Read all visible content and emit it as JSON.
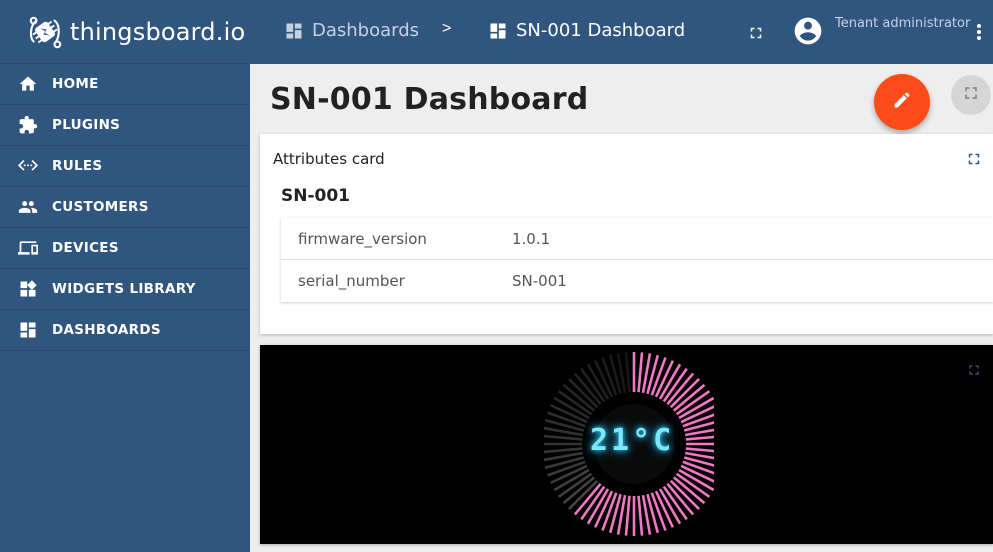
{
  "brand": {
    "name": "thingsboard.io",
    "logo_icon": "thingsboard-logo-icon"
  },
  "sidebar": {
    "items": [
      {
        "label": "HOME",
        "icon": "home-icon"
      },
      {
        "label": "PLUGINS",
        "icon": "puzzle-icon"
      },
      {
        "label": "RULES",
        "icon": "settings-ethernet-icon"
      },
      {
        "label": "CUSTOMERS",
        "icon": "people-icon"
      },
      {
        "label": "DEVICES",
        "icon": "devices-icon"
      },
      {
        "label": "WIDGETS LIBRARY",
        "icon": "widgets-icon"
      },
      {
        "label": "DASHBOARDS",
        "icon": "dashboard-icon"
      }
    ]
  },
  "topbar": {
    "breadcrumb": [
      {
        "label": "Dashboards",
        "icon": "dashboard-icon"
      },
      {
        "label": "SN-001 Dashboard",
        "icon": "dashboard-icon"
      }
    ],
    "separator": ">",
    "user_role": "Tenant administrator"
  },
  "page": {
    "title": "SN-001 Dashboard"
  },
  "attributes_card": {
    "title": "Attributes card",
    "entity_name": "SN-001",
    "rows": [
      {
        "key": "firmware_version",
        "value": "1.0.1"
      },
      {
        "key": "serial_number",
        "value": "SN-001"
      }
    ]
  },
  "gauge": {
    "display_value": "21°C",
    "level_fraction": 0.62
  },
  "colors": {
    "primary": "#305680",
    "accent": "#ff4a1a",
    "gauge_on": "#ff7fd0",
    "gauge_off": "#555555",
    "digits": "#7ae8ff"
  }
}
